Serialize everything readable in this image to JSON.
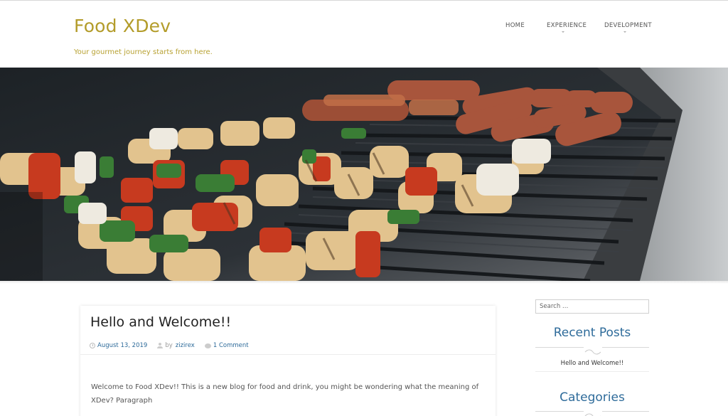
{
  "site": {
    "title": "Food XDev",
    "tagline": "Your gourmet journey starts from here.",
    "colors": {
      "title": "#b39c2a",
      "link": "#2e6b9a"
    }
  },
  "nav": {
    "items": [
      {
        "label": "HOME"
      },
      {
        "label": "EXPERIENCE",
        "has_submenu": true
      },
      {
        "label": "DEVELOPMENT",
        "has_submenu": true
      }
    ]
  },
  "hero": {
    "subject": "grilled kebab skewers and sausages on a barbecue grill"
  },
  "post": {
    "title": "Hello and Welcome!!",
    "date": "August 13, 2019",
    "by_label": "by",
    "author": "zizirex",
    "comments": "1 Comment",
    "excerpt": "Welcome to Food XDev!! This is a new blog for food and drink, you might be wondering what the meaning of XDev? Paragraph",
    "icons": [
      "clock-icon",
      "user-icon",
      "comment-icon"
    ]
  },
  "sidebar": {
    "search_placeholder": "Search …",
    "recent_posts_title": "Recent Posts",
    "recent_posts": [
      "Hello and Welcome!!"
    ],
    "categories_title": "Categories"
  }
}
